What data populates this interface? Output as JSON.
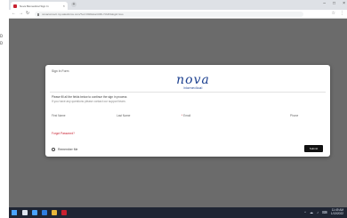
{
  "left_strip": {
    "ticks": [
      "D",
      "D"
    ]
  },
  "browser": {
    "tab": {
      "title": "Nova Biomedical Sign In",
      "close_glyph": "×",
      "favicon_color": "#c8202f"
    },
    "new_tab_glyph": "+",
    "window_controls": [
      "–",
      "□",
      "×"
    ],
    "nav": {
      "back": "←",
      "forward": "→",
      "reload": "↻"
    },
    "url": "novaconnect.my.salesforce.com/?ec=302&startURL=%2F&login=sso",
    "toolbar_icons": [
      "☆",
      "⋮"
    ]
  },
  "dialog": {
    "title": "Sign In Form",
    "logo": {
      "brand": "nova",
      "sub": "biomedical",
      "color": "#1b3f8f"
    },
    "message": {
      "line1": "Please fill all the fields below to continue the sign in process",
      "line2": "If you have any questions please contact our support team."
    },
    "fields": [
      {
        "label": "First Name",
        "required": false
      },
      {
        "label": "Last Name",
        "required": false
      },
      {
        "label": "Email",
        "required": true
      },
      {
        "label": "Phone",
        "required": false
      }
    ],
    "required_mark": "*",
    "link_text": "Forgot Password?",
    "remember_label": "Remember Me",
    "submit_label": "Submit"
  },
  "taskbar": {
    "icon_colors": [
      "#dfe5f0",
      "#4aa3ff",
      "#2f7de1",
      "#e8b63a",
      "#c8202f"
    ],
    "tray_icons": [
      "^",
      "☁",
      "♪",
      "⌨"
    ],
    "clock": {
      "time": "11:49 AM",
      "date": "1/13/2022"
    }
  }
}
